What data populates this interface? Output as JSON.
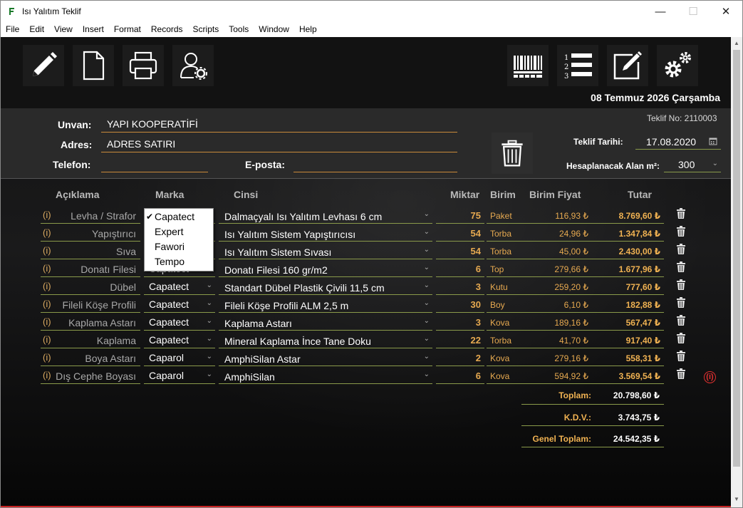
{
  "window": {
    "title": "Isı Yalıtım Teklif",
    "minimize": "—",
    "maximize": "☐",
    "close": "✕"
  },
  "menu": [
    "File",
    "Edit",
    "View",
    "Insert",
    "Format",
    "Records",
    "Scripts",
    "Tools",
    "Window",
    "Help"
  ],
  "toolbar": {
    "left": [
      "pencil-icon",
      "new-document-icon",
      "printer-icon",
      "user-settings-icon"
    ],
    "right": [
      "barcode-icon",
      "numbered-list-icon",
      "edit-note-icon",
      "settings-icon"
    ]
  },
  "date": "08 Temmuz 2026 Çarşamba",
  "header": {
    "unvan_label": "Unvan:",
    "unvan_value": "YAPI KOOPERATİFİ",
    "adres_label": "Adres:",
    "adres_value": "ADRES SATIRI",
    "telefon_label": "Telefon:",
    "telefon_value": "",
    "eposta_label": "E-posta:",
    "eposta_value": "",
    "teklif_no": "Teklif No: 2110003",
    "teklif_tarihi_label": "Teklif Tarihi:",
    "teklif_tarihi_value": "17.08.2020",
    "alan_label": "Hesaplanacak Alan m²:",
    "alan_value": "300"
  },
  "columns": {
    "aciklama": "Açıklama",
    "marka": "Marka",
    "cinsi": "Cinsi",
    "miktar": "Miktar",
    "birim": "Birim",
    "birim_fiyat": "Birim Fiyat",
    "tutar": "Tutar"
  },
  "rows": [
    {
      "info": "(i)",
      "desc": "Levha / Strafor",
      "brand": "Capatect",
      "type": "Dalmaçyalı Isı Yalıtım Levhası 6 cm",
      "qty": "75",
      "unit": "Paket",
      "price": "116,93 ₺",
      "total": "8.769,60 ₺"
    },
    {
      "info": "(i)",
      "desc": "Yapıştırıcı",
      "brand": "Capatect",
      "type": "Isı Yalıtım Sistem Yapıştırıcısı",
      "qty": "54",
      "unit": "Torba",
      "price": "24,96 ₺",
      "total": "1.347,84 ₺"
    },
    {
      "info": "(i)",
      "desc": "Sıva",
      "brand": "Capatect",
      "type": "Isı Yalıtım Sistem Sıvası",
      "qty": "54",
      "unit": "Torba",
      "price": "45,00 ₺",
      "total": "2.430,00 ₺"
    },
    {
      "info": "(i)",
      "desc": "Donatı Filesi",
      "brand": "Capatect",
      "type": "Donatı Filesi 160 gr/m2",
      "qty": "6",
      "unit": "Top",
      "price": "279,66 ₺",
      "total": "1.677,96 ₺"
    },
    {
      "info": "(i)",
      "desc": "Dübel",
      "brand": "Capatect",
      "type": "Standart Dübel Plastik Çivili 11,5 cm",
      "qty": "3",
      "unit": "Kutu",
      "price": "259,20 ₺",
      "total": "777,60 ₺"
    },
    {
      "info": "(i)",
      "desc": "Fileli Köşe Profili",
      "brand": "Capatect",
      "type": "Fileli Köşe Profili ALM 2,5 m",
      "qty": "30",
      "unit": "Boy",
      "price": "6,10 ₺",
      "total": "182,88 ₺"
    },
    {
      "info": "(i)",
      "desc": "Kaplama Astarı",
      "brand": "Capatect",
      "type": "Kaplama Astarı",
      "qty": "3",
      "unit": "Kova",
      "price": "189,16 ₺",
      "total": "567,47 ₺"
    },
    {
      "info": "(i)",
      "desc": "Kaplama",
      "brand": "Capatect",
      "type": "Mineral Kaplama İnce Tane Doku",
      "qty": "22",
      "unit": "Torba",
      "price": "41,70 ₺",
      "total": "917,40 ₺"
    },
    {
      "info": "(i)",
      "desc": "Boya Astarı",
      "brand": "Caparol",
      "type": "AmphiSilan Astar",
      "qty": "2",
      "unit": "Kova",
      "price": "279,16 ₺",
      "total": "558,31 ₺"
    },
    {
      "info": "(i)",
      "desc": "Dış Cephe Boyası",
      "brand": "Caparol",
      "type": "AmphiSilan",
      "qty": "6",
      "unit": "Kova",
      "price": "594,92 ₺",
      "total": "3.569,54 ₺"
    }
  ],
  "dropdown": {
    "selected": "Capatect",
    "options": [
      "Capatect",
      "Expert",
      "Fawori",
      "Tempo"
    ]
  },
  "totals": {
    "toplam_label": "Toplam:",
    "toplam_value": "20.798,60 ₺",
    "kdv_label": "K.D.V.:",
    "kdv_value": "3.743,75 ₺",
    "genel_label": "Genel Toplam:",
    "genel_value": "24.542,35 ₺"
  },
  "warning_icon": "(i)",
  "colors": {
    "accent": "#f0b252",
    "underline": "#8a9a4a",
    "field_line": "#c98a3a"
  }
}
